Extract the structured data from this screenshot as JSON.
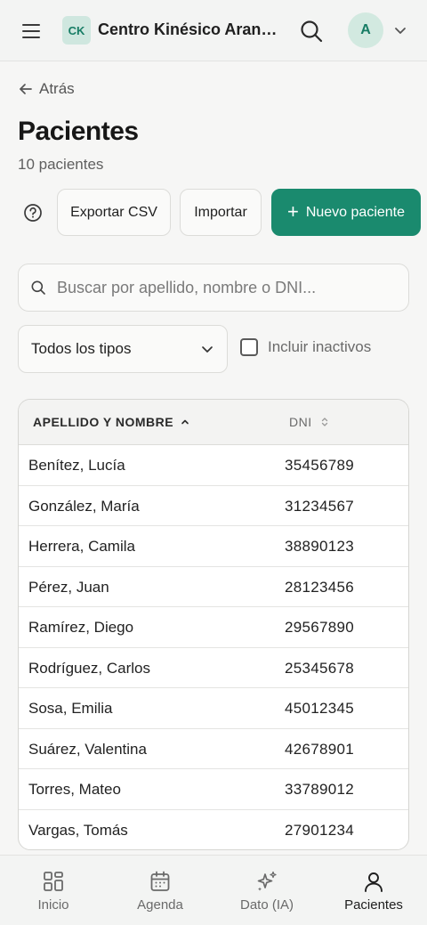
{
  "header": {
    "logo_text": "CK",
    "clinic_name": "Centro Kinésico Aranguren",
    "avatar_initial": "A"
  },
  "nav": {
    "back_label": "Atrás"
  },
  "page": {
    "title": "Pacientes",
    "count_text": "10 pacientes"
  },
  "actions": {
    "export_label": "Exportar CSV",
    "import_label": "Importar",
    "new_label": "Nuevo paciente"
  },
  "filters": {
    "search_placeholder": "Buscar por apellido, nombre o DNI...",
    "type_select_value": "Todos los tipos",
    "include_inactive_label": "Incluir inactivos",
    "include_inactive_checked": false
  },
  "table": {
    "columns": [
      "APELLIDO Y NOMBRE",
      "DNI"
    ],
    "rows": [
      {
        "name": "Benítez, Lucía",
        "dni": "35456789"
      },
      {
        "name": "González, María",
        "dni": "31234567"
      },
      {
        "name": "Herrera, Camila",
        "dni": "38890123"
      },
      {
        "name": "Pérez, Juan",
        "dni": "28123456"
      },
      {
        "name": "Ramírez, Diego",
        "dni": "29567890"
      },
      {
        "name": "Rodríguez, Carlos",
        "dni": "25345678"
      },
      {
        "name": "Sosa, Emilia",
        "dni": "45012345"
      },
      {
        "name": "Suárez, Valentina",
        "dni": "42678901"
      },
      {
        "name": "Torres, Mateo",
        "dni": "33789012"
      },
      {
        "name": "Vargas, Tomás",
        "dni": "27901234"
      }
    ]
  },
  "bottom_nav": {
    "items": [
      {
        "label": "Inicio",
        "icon": "grid-icon"
      },
      {
        "label": "Agenda",
        "icon": "calendar-icon"
      },
      {
        "label": "Dato (IA)",
        "icon": "sparkles-icon"
      },
      {
        "label": "Pacientes",
        "icon": "user-icon"
      }
    ],
    "active": "Pacientes"
  },
  "colors": {
    "accent": "#1a8a6e",
    "accent_soft": "#d2e9e0",
    "background": "#f6f6f5"
  }
}
